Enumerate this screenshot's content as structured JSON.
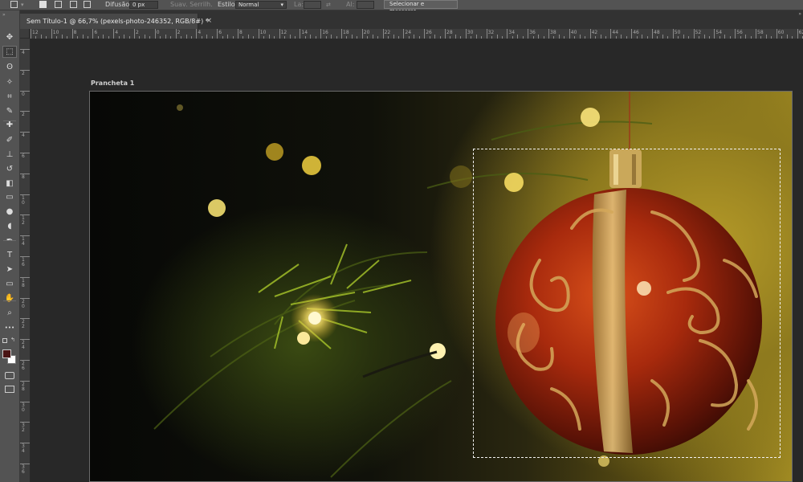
{
  "options_bar": {
    "feather_label": "Difusão:",
    "feather_value": "0 px",
    "antialias_label": "Suav. Serrilh.",
    "style_label": "Estilo:",
    "style_value": "Normal",
    "width_label": "La:",
    "height_label": "Al:",
    "select_mask_button": "Selecionar e mascarar..."
  },
  "document_tab": {
    "title": "Sem Título-1 @ 66,7% (pexels-photo-246352, RGB/8#) *",
    "close": "×"
  },
  "artboard": {
    "label": "Prancheta 1"
  },
  "rulers": {
    "top_labels": [
      "12",
      "10",
      "8",
      "6",
      "4",
      "2",
      "0",
      "2",
      "4",
      "6",
      "8",
      "10",
      "12",
      "14",
      "16",
      "18",
      "20",
      "22",
      "24",
      "26",
      "28",
      "30",
      "32",
      "34",
      "36",
      "38",
      "40",
      "42",
      "44",
      "46",
      "48",
      "50",
      "52",
      "54",
      "56",
      "58",
      "60",
      "62",
      "64",
      "66"
    ],
    "left_labels": [
      "4",
      "2",
      "0",
      "2",
      "4",
      "6",
      "8",
      "1\n0",
      "1\n2",
      "1\n4",
      "1\n6",
      "1\n8",
      "2\n0",
      "2\n2",
      "2\n4",
      "2\n6",
      "2\n8",
      "3\n0",
      "3\n2",
      "3\n4",
      "3\n6"
    ]
  },
  "tools": [
    {
      "name": "move-tool-icon",
      "glyph": "✥",
      "active": false
    },
    {
      "name": "rect-marquee-tool-icon",
      "glyph": "⬚",
      "active": true
    },
    {
      "name": "lasso-tool-icon",
      "glyph": "ʘ",
      "active": false
    },
    {
      "name": "magic-wand-tool-icon",
      "glyph": "✧",
      "active": false
    },
    {
      "name": "crop-tool-icon",
      "glyph": "⌗",
      "active": false
    },
    {
      "name": "eyedropper-tool-icon",
      "glyph": "✎",
      "active": false
    },
    {
      "name": "healing-brush-tool-icon",
      "glyph": "✚",
      "active": false
    },
    {
      "name": "brush-tool-icon",
      "glyph": "✐",
      "active": false
    },
    {
      "name": "clone-stamp-tool-icon",
      "glyph": "⊥",
      "active": false
    },
    {
      "name": "history-brush-tool-icon",
      "glyph": "↺",
      "active": false
    },
    {
      "name": "eraser-tool-icon",
      "glyph": "◧",
      "active": false
    },
    {
      "name": "gradient-tool-icon",
      "glyph": "▭",
      "active": false
    },
    {
      "name": "blur-tool-icon",
      "glyph": "●",
      "active": false
    },
    {
      "name": "dodge-tool-icon",
      "glyph": "◖",
      "active": false
    },
    {
      "name": "pen-tool-icon",
      "glyph": "✒",
      "active": false
    },
    {
      "name": "type-tool-icon",
      "glyph": "T",
      "active": false
    },
    {
      "name": "path-selection-tool-icon",
      "glyph": "➤",
      "active": false
    },
    {
      "name": "rectangle-shape-tool-icon",
      "glyph": "▭",
      "active": false
    },
    {
      "name": "hand-tool-icon",
      "glyph": "✋",
      "active": false
    },
    {
      "name": "zoom-tool-icon",
      "glyph": "⌕",
      "active": false
    },
    {
      "name": "edit-toolbar-icon",
      "glyph": "•••",
      "active": false
    }
  ],
  "colors": {
    "foreground": "#4a1414",
    "background": "#ffffff",
    "ornament_red": "#b5300f",
    "glitter_gold": "#d8b050"
  }
}
